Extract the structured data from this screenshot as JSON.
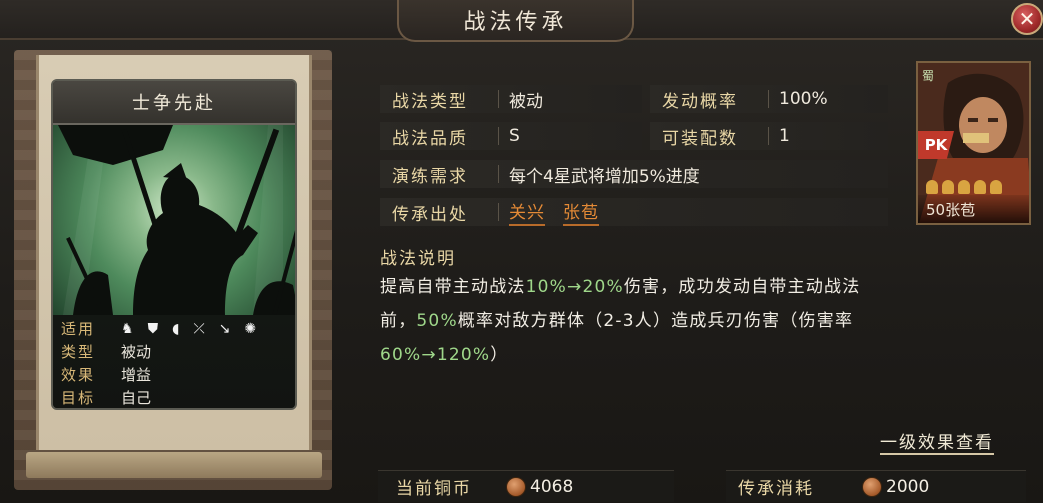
{
  "window": {
    "title": "战法传承",
    "close_symbol": "✕"
  },
  "card": {
    "name": "士争先赴",
    "rows": [
      {
        "key": "适用",
        "icons": [
          "cavalry-icon",
          "shield-icon",
          "shield-infantry-icon",
          "bow-icon",
          "spear-icon",
          "wheel-icon"
        ]
      },
      {
        "key": "类型",
        "value": "被动"
      },
      {
        "key": "效果",
        "value": "增益"
      },
      {
        "key": "目标",
        "value": "自己"
      }
    ]
  },
  "details": {
    "type_key": "战法类型",
    "type_val": "被动",
    "prob_key": "发动概率",
    "prob_val": "100%",
    "quality_key": "战法品质",
    "quality_val": "S",
    "equip_key": "可装配数",
    "equip_val": "1",
    "practice_key": "演练需求",
    "practice_val": "每个4星武将增加5%进度",
    "source_key": "传承出处",
    "source_1": "关兴",
    "source_2": "张苞"
  },
  "description": {
    "title": "战法说明",
    "p1a": "提高自带主动战法",
    "p1b": "10%→20%",
    "p1c": "伤害，成功发动自带主动战法",
    "p2a": "前，",
    "p2b": "50%",
    "p2c": "概率对敌方群体（2-3人）造成兵刃伤害（伤害率",
    "p3a": "60%→120%",
    "p3b": "）"
  },
  "effect_link": "一级效果查看",
  "hero": {
    "faction": "蜀",
    "badge": "PK",
    "level_name": "50张苞",
    "stars": 5
  },
  "footer": {
    "copper_label": "当前铜币",
    "copper_val": "4068",
    "cost_label": "传承消耗",
    "cost_val": "2000"
  },
  "colors": {
    "accent_orange": "#e48a36",
    "value_green": "#9fd78a",
    "key_gold": "#e9d7a6"
  }
}
